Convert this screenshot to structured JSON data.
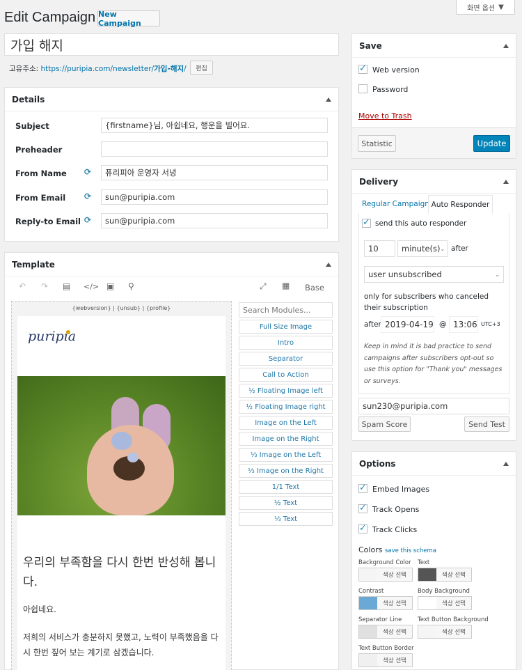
{
  "header": {
    "title": "Edit Campaign",
    "new_campaign": "New Campaign",
    "screen_options": "화면 옵션"
  },
  "campaign": {
    "name": "가입 해지",
    "permalink_label": "고유주소:",
    "permalink_base": "https://puripia.com/newsletter/",
    "permalink_slug": "가입-해지",
    "permalink_end": "/",
    "edit_label": "편집"
  },
  "details": {
    "title": "Details",
    "subject_label": "Subject",
    "subject_value": "{firstname}님, 아쉽네요, 행운을 빌어요.",
    "preheader_label": "Preheader",
    "preheader_value": "",
    "from_name_label": "From Name",
    "from_name_value": "퓨리피아 운영자 서녕",
    "from_email_label": "From Email",
    "from_email_value": "sun@puripia.com",
    "reply_label": "Reply-to Email",
    "reply_value": "sun@puripia.com"
  },
  "template": {
    "title": "Template",
    "base": "Base",
    "tags": "{webversion} | {unsub} | {profile}",
    "logo": "puripia",
    "headline": "우리의 부족함을 다시 한번 반성해 봅니다.",
    "p1": "아쉽네요.",
    "p2": "저희의 서비스가 충분하지 못했고, 노력이 부족했음을 다시 한번 짚어 보는 계기로 삼겠습니다.",
    "search_placeholder": "Search Modules...",
    "modules": [
      "Full Size Image",
      "Intro",
      "Separator",
      "Call to Action",
      "½ Floating Image left",
      "½ Floating Image right",
      "Image on the Left",
      "Image on the Right",
      "⅓ Image on the Left",
      "⅓ Image on the Right",
      "1/1 Text",
      "½ Text",
      "⅓ Text"
    ]
  },
  "save": {
    "title": "Save",
    "web_version": "Web version",
    "password": "Password",
    "trash": "Move to Trash",
    "statistic": "Statistic",
    "update": "Update"
  },
  "delivery": {
    "title": "Delivery",
    "tab_regular": "Regular Campaign",
    "tab_auto": "Auto Responder",
    "send_auto": "send this auto responder",
    "amount": "10",
    "unit": "minute(s)",
    "after": "after",
    "event": "user unsubscribed",
    "only_text": "only for subscribers who canceled their subscription",
    "after_label": "after",
    "date": "2019-04-19",
    "at": "@",
    "time": "13:06",
    "tz": "UTC+3",
    "note": "Keep in mind it is bad practice to send campaigns after subscribers opt-out so use this option for \"Thank you\" messages or surveys.",
    "test_email": "sun230@puripia.com",
    "spam": "Spam Score",
    "send_test": "Send Test"
  },
  "options": {
    "title": "Options",
    "embed": "Embed Images",
    "opens": "Track Opens",
    "clicks": "Track Clicks",
    "colors": "Colors",
    "save_schema": "save this schema",
    "select": "색상 선택",
    "swatches": [
      {
        "label": "Background Color",
        "color": "#f5f5f5"
      },
      {
        "label": "Text",
        "color": "#555555"
      },
      {
        "label": "Contrast",
        "color": "#6aa9d6"
      },
      {
        "label": "Body Background",
        "color": "#ffffff"
      },
      {
        "label": "Separator Line",
        "color": "#e0e0e0"
      },
      {
        "label": "Text Button Background",
        "color": "#f5f5f5"
      },
      {
        "label": "Text Button Border",
        "color": "#f0f0f0"
      }
    ]
  }
}
